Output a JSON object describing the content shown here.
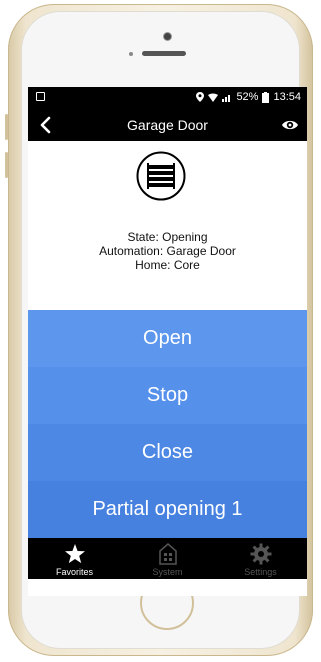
{
  "status_bar": {
    "signal": "◉ ☃ .░",
    "battery": "52%",
    "time": "13:54"
  },
  "nav": {
    "title": "Garage Door"
  },
  "device": {
    "state_label": "State:",
    "state_value": "Opening",
    "automation_label": "Automation:",
    "automation_value": "Garage Door",
    "home_label": "Home:",
    "home_value": "Core"
  },
  "actions": [
    {
      "label": "Open",
      "color": "#5d97ed"
    },
    {
      "label": "Stop",
      "color": "#5590eb"
    },
    {
      "label": "Close",
      "color": "#4d88e5"
    },
    {
      "label": "Partial opening 1",
      "color": "#4681e0"
    }
  ],
  "tabs": [
    {
      "label": "Favorites",
      "icon": "star-icon",
      "active": true
    },
    {
      "label": "System",
      "icon": "system-icon",
      "active": false
    },
    {
      "label": "Settings",
      "icon": "gear-icon",
      "active": false
    }
  ],
  "colors": {
    "active_tab": "#ffffff",
    "inactive_tab": "#555555",
    "phone_gold": "#efe5cf"
  }
}
